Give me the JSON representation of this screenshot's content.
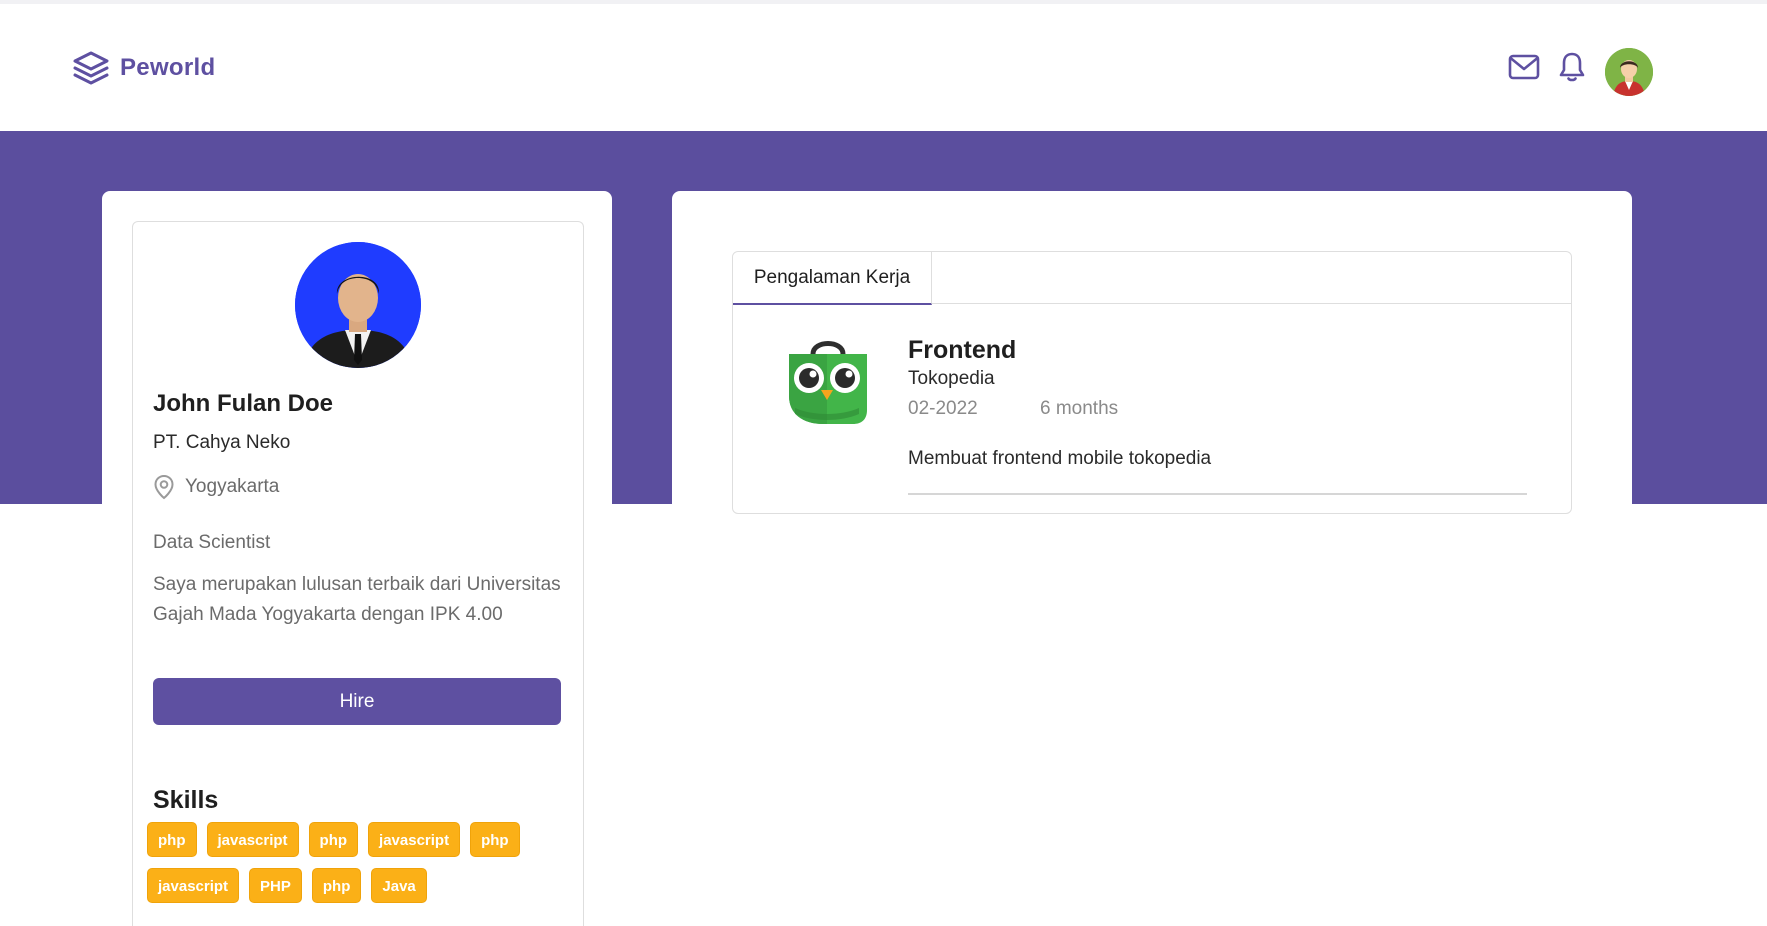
{
  "brand": {
    "name": "Peworld",
    "icon": "layers-icon"
  },
  "header": {
    "icons": [
      "mail-icon",
      "bell-icon"
    ],
    "avatar": "user-avatar"
  },
  "profile": {
    "name": "John Fulan Doe",
    "company": "PT. Cahya Neko",
    "location": "Yogyakarta",
    "job_title": "Data Scientist",
    "bio": "Saya merupakan lulusan terbaik dari Universitas Gajah Mada Yogyakarta dengan IPK 4.00",
    "hire_label": "Hire"
  },
  "skills": {
    "title": "Skills",
    "items": [
      "php",
      "javascript",
      "php",
      "javascript",
      "php",
      "javascript",
      "PHP",
      "php",
      "Java"
    ]
  },
  "experience": {
    "tab_label": "Pengalaman Kerja",
    "items": [
      {
        "role": "Frontend",
        "company": "Tokopedia",
        "date": "02-2022",
        "duration": "6 months",
        "description": "Membuat frontend mobile tokopedia"
      }
    ]
  },
  "colors": {
    "primary": "#5e50a1",
    "band": "#5b4e9e",
    "skill_badge": "#fbb017"
  }
}
